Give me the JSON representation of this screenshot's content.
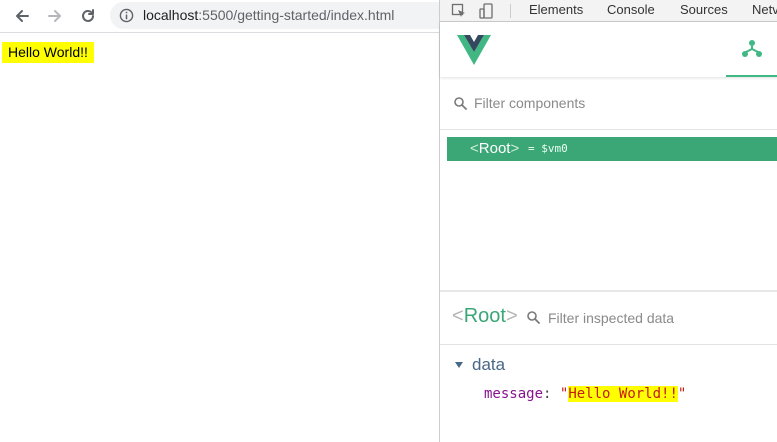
{
  "browser": {
    "url_host": "localhost",
    "url_path": ":5500/getting-started/index.html",
    "page_text": "Hello World!!"
  },
  "devtools": {
    "tabs": [
      "Elements",
      "Console",
      "Sources",
      "Netv"
    ]
  },
  "vue_devtools": {
    "filter_components_placeholder": "Filter components",
    "component_tree": [
      {
        "name": "Root",
        "open_bracket": "<",
        "close_bracket": ">",
        "instance": "= $vm0",
        "selected": true
      }
    ],
    "inspector": {
      "component_name": "Root",
      "filter_placeholder": "Filter inspected data",
      "section": "data",
      "properties": [
        {
          "key": "message",
          "value": "Hello World!!"
        }
      ]
    }
  },
  "colors": {
    "vue_green": "#41b883",
    "selected_row": "#3ba776",
    "highlight": "#ffff00"
  }
}
